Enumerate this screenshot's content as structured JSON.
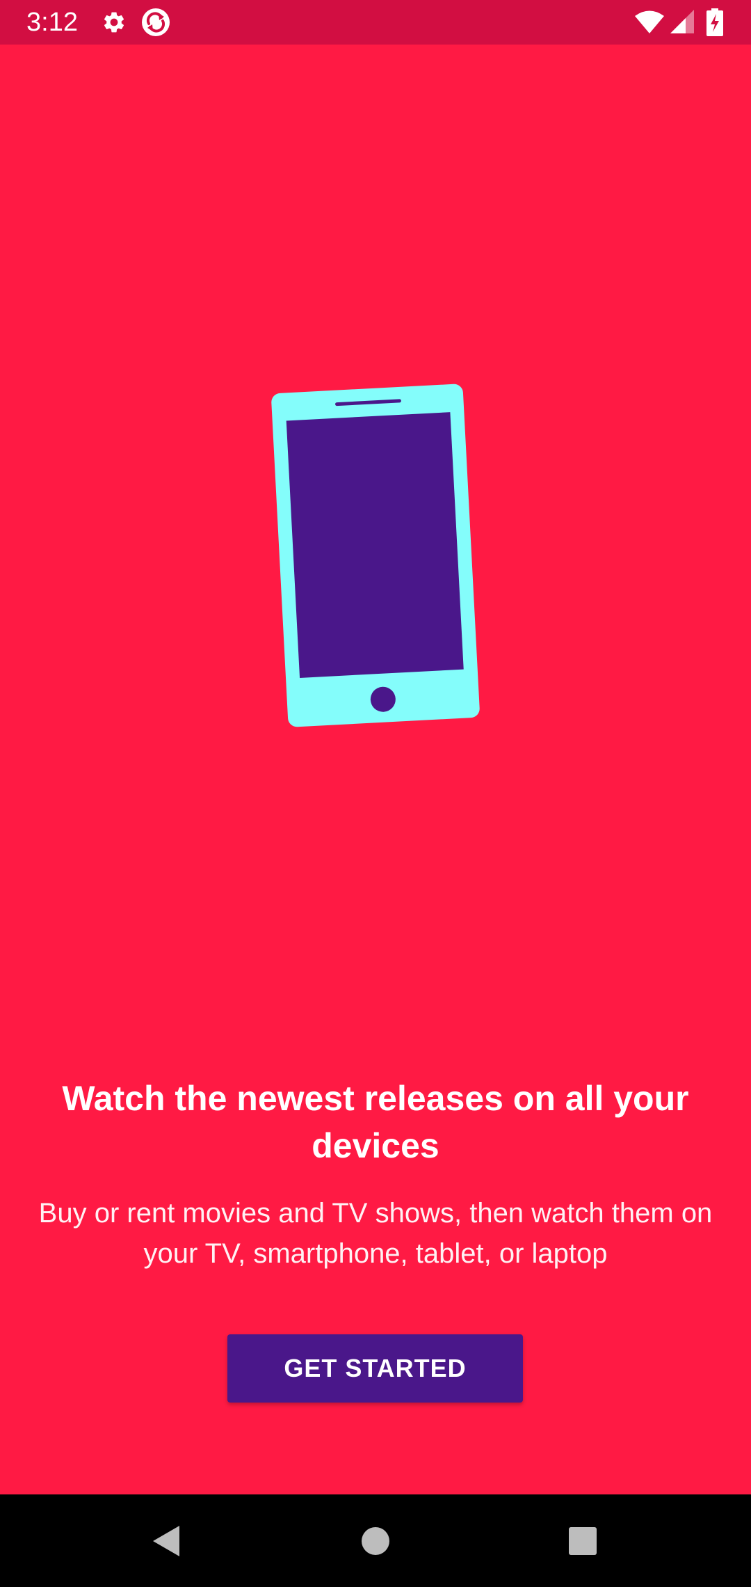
{
  "status_bar": {
    "time": "3:12",
    "icons": [
      "gear-icon",
      "sync-icon",
      "wifi-icon",
      "signal-icon",
      "battery-charging-icon"
    ],
    "background_color": "#D20E42"
  },
  "hero": {
    "icon": "smartphone-illustration",
    "body_color": "#84FDFB",
    "screen_color": "#4A178A"
  },
  "onboarding": {
    "headline": "Watch the newest releases on all your devices",
    "subtitle": "Buy or rent movies and TV shows, then watch them on your TV, smartphone, tablet, or laptop",
    "background_color": "#FF1A44"
  },
  "cta": {
    "label": "GET STARTED",
    "color": "#4A178A"
  },
  "nav_bar": {
    "buttons": [
      "back-icon",
      "home-icon",
      "recents-icon"
    ]
  }
}
